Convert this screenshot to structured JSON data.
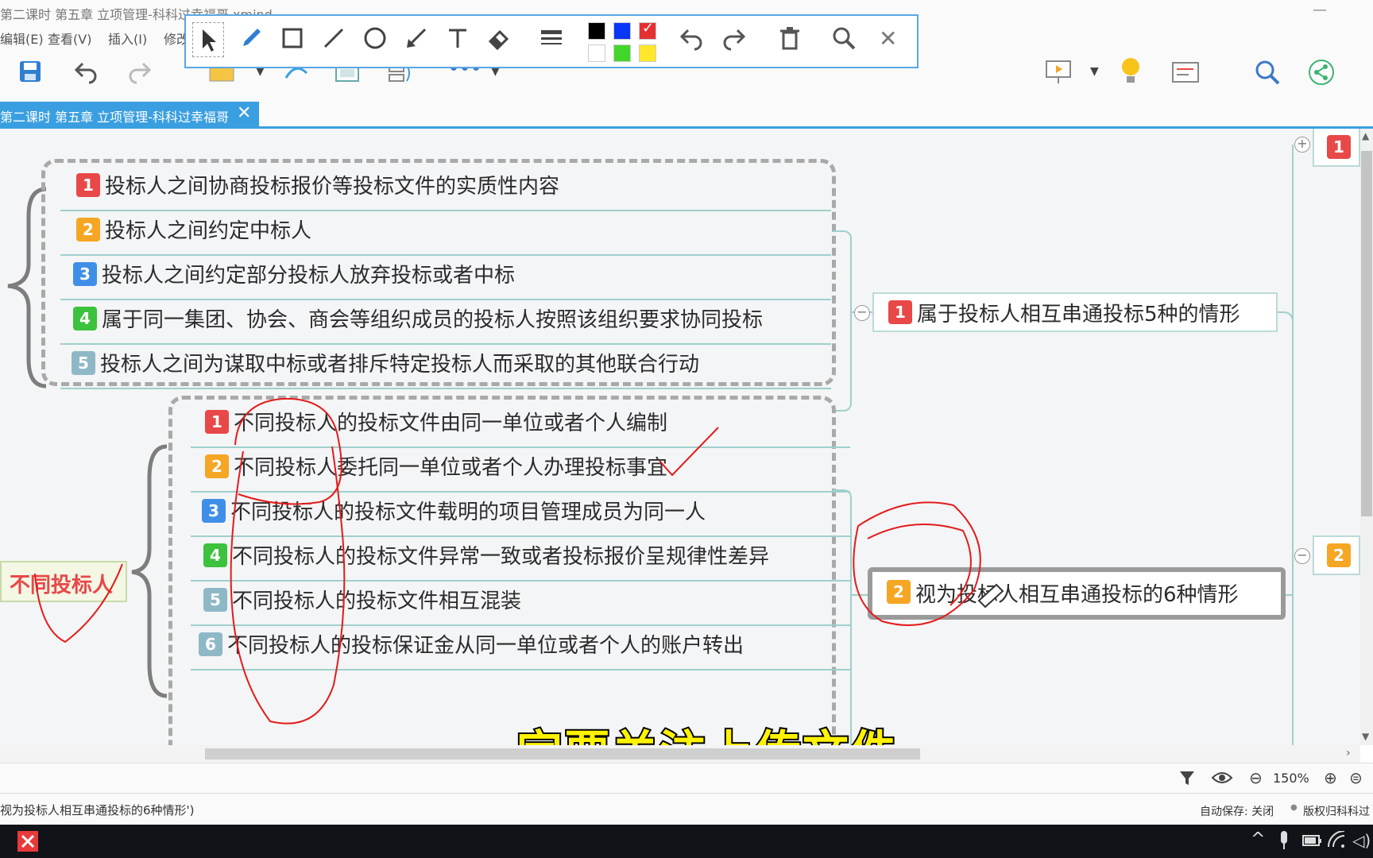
{
  "window": {
    "title": "第二课时 第五章  立项管理-科科过幸福哥.xmind"
  },
  "menu": [
    "编辑(E)",
    "查看(V)",
    "插入(I)",
    "修改"
  ],
  "tab": {
    "label": "第二课时 第五章  立项管理-科科过幸福哥",
    "close": "✕"
  },
  "annotation_colors": [
    "#000000",
    "#0a36f5",
    "#e53030",
    "#ffffff",
    "#43d62a",
    "#ffe82a"
  ],
  "canvas": {
    "group1": {
      "items": [
        {
          "num": "1",
          "text": "投标人之间协商投标报价等投标文件的实质性内容"
        },
        {
          "num": "2",
          "text": "投标人之间约定中标人"
        },
        {
          "num": "3",
          "text": "投标人之间约定部分投标人放弃投标或者中标"
        },
        {
          "num": "4",
          "text": "属于同一集团、协会、商会等组织成员的投标人按照该组织要求协同投标"
        },
        {
          "num": "5",
          "text": "投标人之间为谋取中标或者排斥特定投标人而采取的其他联合行动"
        }
      ],
      "parent": {
        "num": "1",
        "text": "属于投标人相互串通投标5种的情形"
      }
    },
    "group2": {
      "label": "不同投标人",
      "items": [
        {
          "num": "1",
          "text": "不同投标人的投标文件由同一单位或者个人编制"
        },
        {
          "num": "2",
          "text": "不同投标人委托同一单位或者个人办理投标事宜"
        },
        {
          "num": "3",
          "text": "不同投标人的投标文件载明的项目管理成员为同一人"
        },
        {
          "num": "4",
          "text": "不同投标人的投标文件异常一致或者投标报价呈规律性差异"
        },
        {
          "num": "5",
          "text": "不同投标人的投标文件相互混装"
        },
        {
          "num": "6",
          "text": "不同投标人的投标保证金从同一单位或者个人的账户转出"
        }
      ],
      "parent": {
        "num": "2",
        "text": "视为投标人相互串通投标的6种情形"
      }
    },
    "right_badges": [
      "1",
      "2"
    ]
  },
  "subtitle": "一定要关注上传文件",
  "zoom": {
    "value": "150%"
  },
  "status": {
    "selection": "视为投标人相互串通投标的6种情形')",
    "autosave": "自动保存: 关闭",
    "copyright": "版权归科科过"
  }
}
